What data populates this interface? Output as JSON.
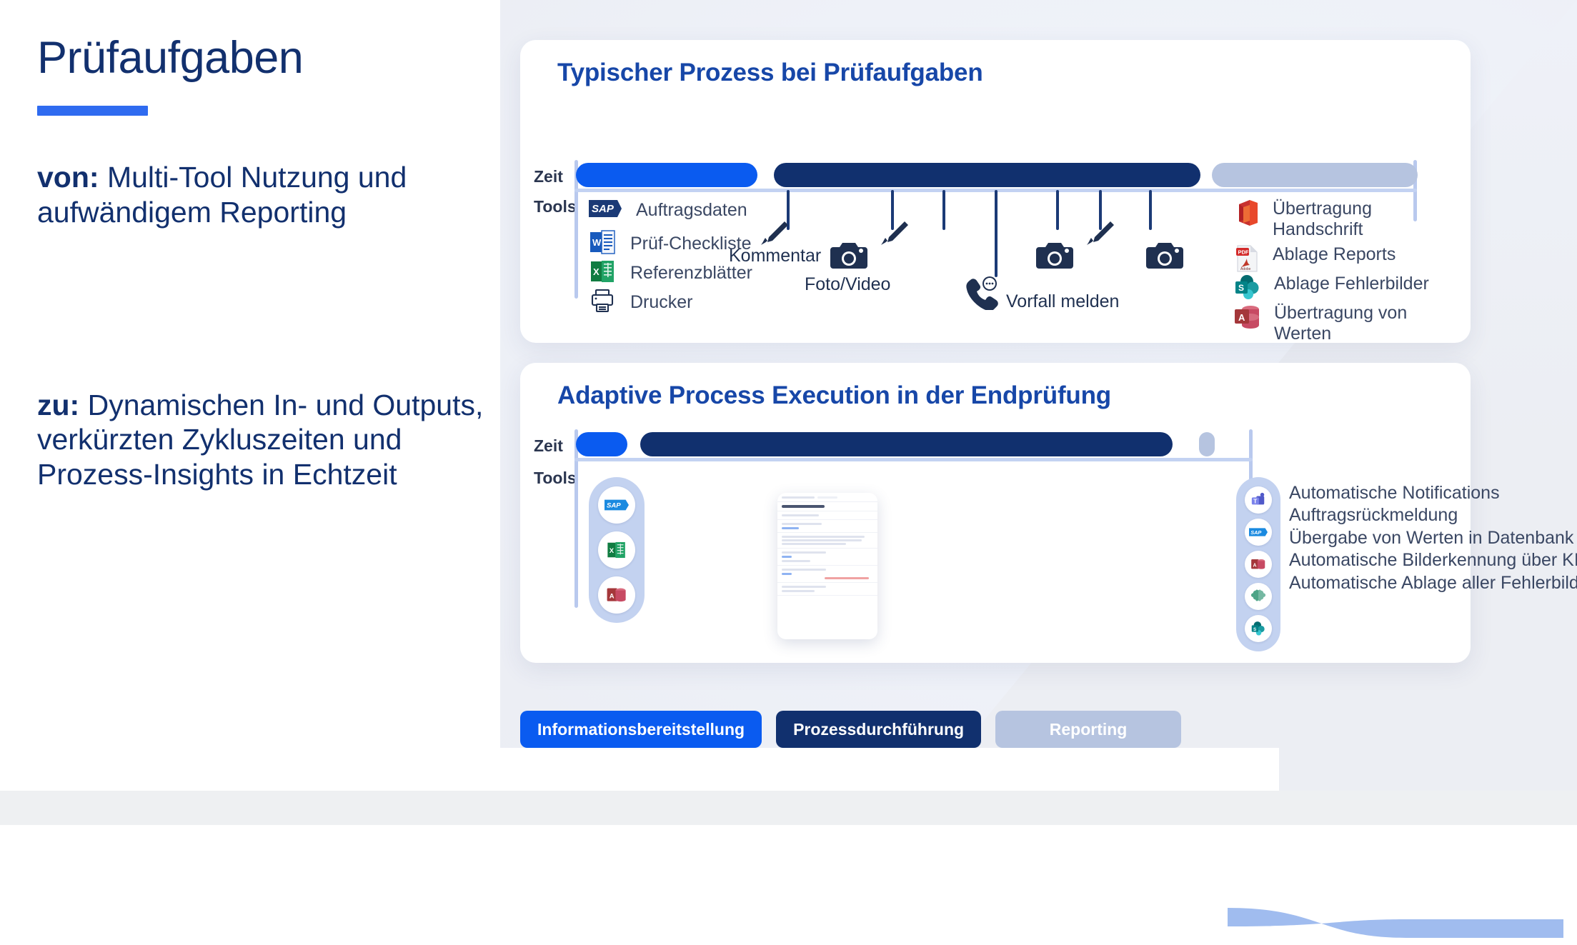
{
  "left": {
    "title": "Prüfaufgaben",
    "from_prefix": "von:",
    "from_text": " Multi-Tool Nutzung und aufwändigem Reporting",
    "to_prefix": "zu:",
    "to_text": " Dynamischen In- und Outputs, verkürzten Zykluszeiten und Prozess-Insights in Echtzeit"
  },
  "card_typical": {
    "title": "Typischer Prozess bei Prüfaufgaben",
    "axis": {
      "time_label": "Zeit",
      "tools_label": "Tools"
    },
    "timeline": [
      {
        "name": "Informationsbereitstellung",
        "color": "#0a5bf0",
        "start_pct": 0,
        "width_pct": 21.5
      },
      {
        "name": "Prozessdurchführung",
        "color": "#11306e",
        "start_pct": 23.5,
        "width_pct": 50.5
      },
      {
        "name": "Reporting",
        "color": "#b6c4e0",
        "start_pct": 75.5,
        "width_pct": 24.5
      }
    ],
    "tools_left": [
      {
        "icon": "sap-icon",
        "label": "Auftragsdaten"
      },
      {
        "icon": "word-icon",
        "label": "Prüf-Checkliste"
      },
      {
        "icon": "excel-icon",
        "label": "Referenzblätter"
      },
      {
        "icon": "printer-icon",
        "label": "Drucker"
      }
    ],
    "activities": [
      {
        "icon": "pencil-icon",
        "label": "Kommentar"
      },
      {
        "icon": "camera-icon",
        "label": "Foto/Video"
      },
      {
        "icon": "pencil-icon",
        "label": ""
      },
      {
        "icon": "phone-message-icon",
        "label": "Vorfall melden"
      },
      {
        "icon": "camera-icon",
        "label": ""
      },
      {
        "icon": "pencil-icon",
        "label": ""
      },
      {
        "icon": "camera-icon",
        "label": ""
      }
    ],
    "tools_right": [
      {
        "icon": "office-icon",
        "label": "Übertragung Handschrift"
      },
      {
        "icon": "pdf-icon",
        "label": "Ablage Reports"
      },
      {
        "icon": "sharepoint-icon",
        "label": "Ablage Fehlerbilder"
      },
      {
        "icon": "access-icon",
        "label": "Übertragung von Werten"
      }
    ]
  },
  "card_adaptive": {
    "title": "Adaptive Process Execution in der Endprüfung",
    "axis": {
      "time_label": "Zeit",
      "tools_label": "Tools"
    },
    "timeline": [
      {
        "name": "Informationsbereitstellung",
        "color": "#0a5bf0",
        "start_pct": 0,
        "width_pct": 7.5
      },
      {
        "name": "Prozessdurchführung",
        "color": "#11306e",
        "start_pct": 10.5,
        "width_pct": 78.5
      },
      {
        "name": "Reporting",
        "color": "#b6c4e0",
        "start_pct": 92.5,
        "width_pct": 2.2
      }
    ],
    "inputs": [
      {
        "icon": "sap-icon"
      },
      {
        "icon": "excel-icon"
      },
      {
        "icon": "access-icon"
      }
    ],
    "outputs": [
      {
        "icon": "teams-icon",
        "label": "Automatische Notifications"
      },
      {
        "icon": "sap-icon",
        "label": "Auftragsrückmeldung"
      },
      {
        "icon": "access-icon",
        "label": "Übergabe von Werten in Datenbank"
      },
      {
        "icon": "brain-ai-icon",
        "label": "Automatische Bilderkennung über KI"
      },
      {
        "icon": "sharepoint-icon",
        "label": "Automatische Ablage aller Fehlerbilder sowie des Reports"
      }
    ],
    "device": {
      "name": "tablet-app-mockup"
    }
  },
  "legend": [
    {
      "label": "Informationsbereitstellung",
      "color": "#0a5bf0"
    },
    {
      "label": "Prozessdurchführung",
      "color": "#11306e"
    },
    {
      "label": "Reporting",
      "color": "#b6c4e0"
    }
  ],
  "colors": {
    "brand_blue": "#0a5bf0",
    "brand_navy": "#11306e",
    "muted_blue": "#b6c4e0",
    "title_blue": "#1747a8",
    "text_navy": "#12306e",
    "body_text": "#3a4763"
  }
}
